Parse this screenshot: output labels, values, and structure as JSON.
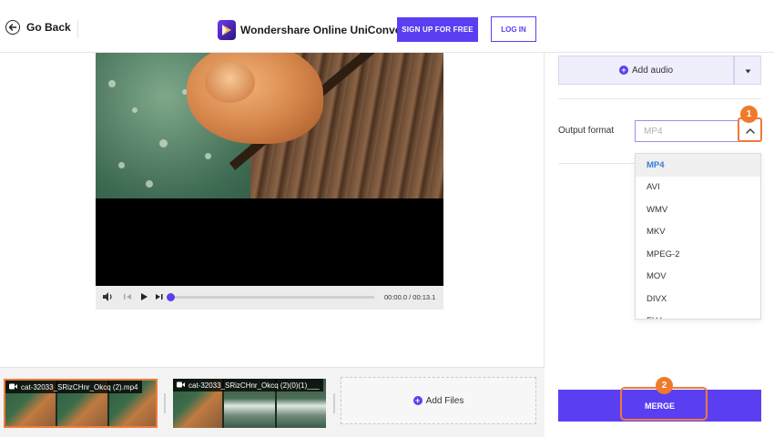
{
  "header": {
    "go_back": "Go Back",
    "brand_name": "Wondershare Online UniConverter",
    "signup_label": "SIGN UP FOR FREE",
    "login_label": "LOG IN"
  },
  "player": {
    "time": "00:00.0 / 00:13.1",
    "progress": 0.02
  },
  "timeline": {
    "clips": [
      {
        "label": "cat-32033_SRizCHnr_Okcq (2).mp4"
      },
      {
        "label": "cat-32033_SRizCHnr_Okcq (2)(0)(1)___"
      }
    ],
    "add_files_label": "Add Files"
  },
  "right_panel": {
    "add_audio_label": "Add audio",
    "output_format_label": "Output format",
    "output_format_placeholder": "MP4",
    "formats": [
      "MP4",
      "AVI",
      "WMV",
      "MKV",
      "MPEG-2",
      "MOV",
      "DIVX",
      "FLV"
    ],
    "selected_format": "MP4",
    "merge_label": "MERGE"
  },
  "annotations": {
    "step1": "1",
    "step2": "2"
  },
  "colors": {
    "accent": "#5a3ff2",
    "highlight": "#f07a3a",
    "selected_text": "#3a7bd5"
  }
}
